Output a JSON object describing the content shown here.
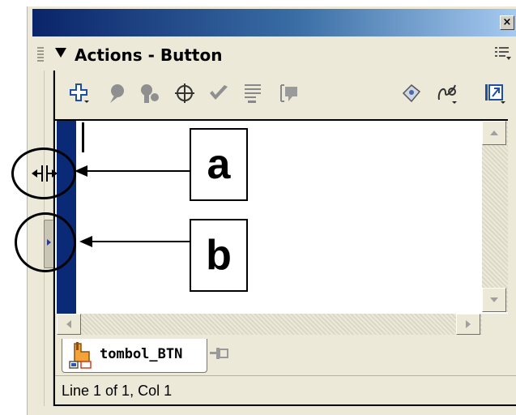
{
  "panel": {
    "title": "Actions - Button"
  },
  "window": {
    "close_glyph": "×"
  },
  "toolbar": {
    "left_icons": [
      "add-statement-icon",
      "find-icon",
      "replace-icon",
      "target-path-icon",
      "check-syntax-icon",
      "auto-format-icon",
      "code-hint-icon"
    ],
    "right_icons": [
      "reference-icon",
      "debug-options-icon",
      "view-options-icon"
    ]
  },
  "editor": {
    "content": ""
  },
  "script_tab": {
    "label": "tombol_BTN"
  },
  "status": {
    "text": "Line 1 of 1, Col 1"
  },
  "annotations": {
    "a": "a",
    "b": "b"
  },
  "colors": {
    "titlebar_start": "#0a246a",
    "titlebar_end": "#a6caf0",
    "gutter": "#0a2a78",
    "panel_bg": "#ece9d8"
  }
}
